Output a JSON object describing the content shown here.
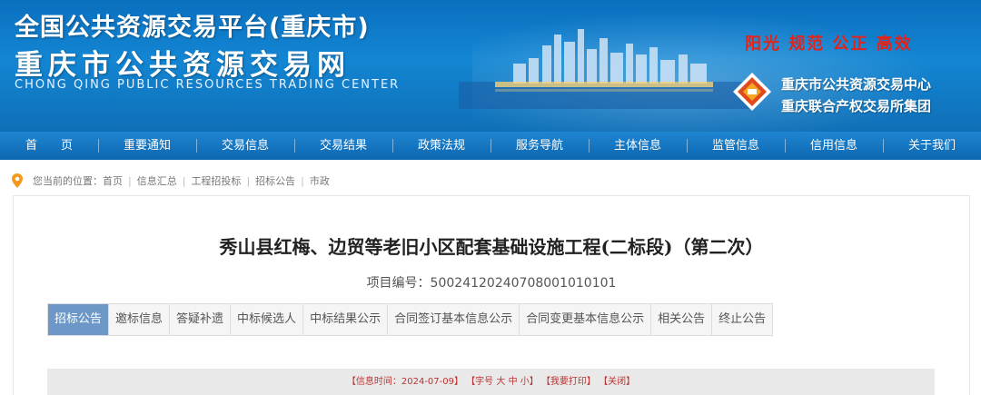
{
  "header": {
    "title_main": "全国公共资源交易平台(重庆市)",
    "title_sub": "重庆市公共资源交易网",
    "title_en": "CHONG QING PUBLIC RESOURCES TRADING CENTER",
    "slogan": "阳光  规范  公正  高效",
    "org_line1": "重庆市公共资源交易中心",
    "org_line2": "重庆联合产权交易所集团"
  },
  "nav": {
    "items": [
      "首　　页",
      "重要通知",
      "交易信息",
      "交易结果",
      "政策法规",
      "服务导航",
      "主体信息",
      "监管信息",
      "信用信息",
      "关于我们"
    ]
  },
  "breadcrumb": {
    "prefix": "您当前的位置：",
    "items": [
      "首页",
      "信息汇总",
      "工程招投标",
      "招标公告",
      "市政"
    ]
  },
  "article": {
    "title": "秀山县红梅、边贸等老旧小区配套基础设施工程(二标段)（第二次）",
    "project_no": "项目编号：50024120240708001010101"
  },
  "tabs": {
    "items": [
      "招标公告",
      "邀标信息",
      "答疑补遗",
      "中标候选人",
      "中标结果公示",
      "合同签订基本信息公示",
      "合同变更基本信息公示",
      "相关公告",
      "终止公告"
    ],
    "active_index": 0
  },
  "infobar": {
    "info_time": "【信息时间：2024-07-09】",
    "font_label": "【字号",
    "font_big": "大",
    "font_mid": "中",
    "font_small": "小】",
    "print": "【我要打印】",
    "close": "【关闭】"
  },
  "colors": {
    "banner_blue": "#1386d3",
    "nav_blue": "#0d66b0",
    "slogan_red": "#e0241b",
    "active_tab": "#6c97c6",
    "infobar_text": "#b33333"
  }
}
